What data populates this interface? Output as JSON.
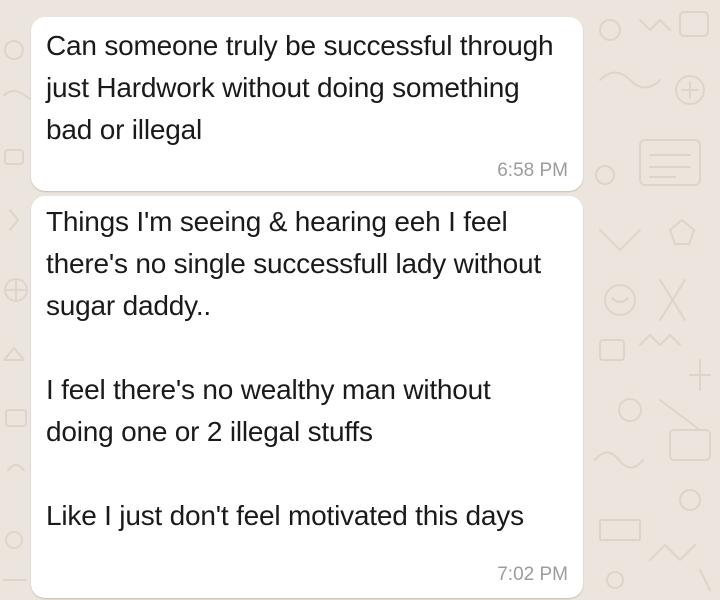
{
  "chat": {
    "messages": [
      {
        "text": "Can someone truly be successful through just Hardwork without doing something bad or illegal",
        "time": "6:58 PM"
      },
      {
        "text": "Things I'm seeing & hearing eeh I feel there's no single successfull lady without sugar daddy..\n\nI feel there's no wealthy man without doing one or 2 illegal stuffs\n\nLike I just don't feel motivated this days",
        "time": "7:02 PM"
      }
    ]
  },
  "colors": {
    "background": "#ece5dd",
    "bubble": "#ffffff",
    "text": "#1a1a1a",
    "timestamp": "#9c9c9c",
    "doodle": "#ddd5cb"
  }
}
